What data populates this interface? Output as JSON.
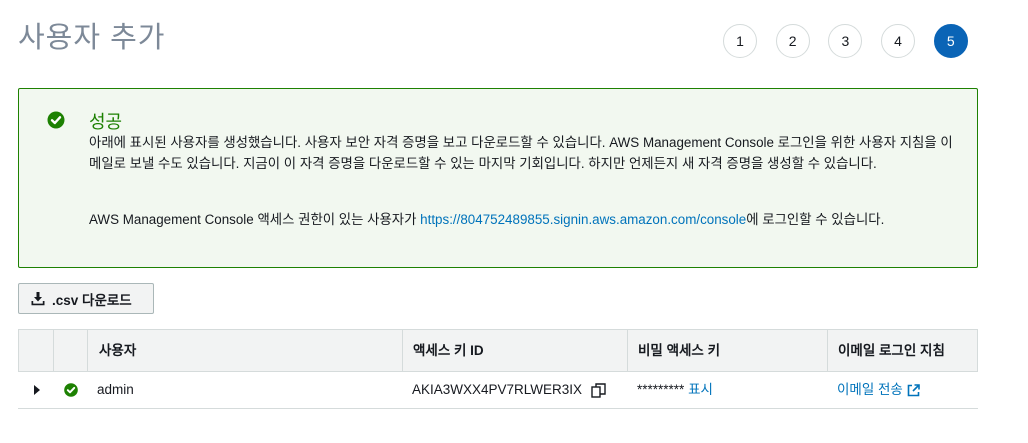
{
  "page": {
    "title": "사용자 추가"
  },
  "steps": [
    {
      "label": "1",
      "active": false
    },
    {
      "label": "2",
      "active": false
    },
    {
      "label": "3",
      "active": false
    },
    {
      "label": "4",
      "active": false
    },
    {
      "label": "5",
      "active": true
    }
  ],
  "alert": {
    "icon": "check-circle-icon",
    "title": "성공",
    "body": "아래에 표시된 사용자를 생성했습니다. 사용자 보안 자격 증명을 보고 다운로드할 수 있습니다. AWS Management Console 로그인을 위한 사용자 지침을 이메일로 보낼 수도 있습니다. 지금이 이 자격 증명을 다운로드할 수 있는 마지막 기회입니다. 하지만 언제든지 새 자격 증명을 생성할 수 있습니다.",
    "console_prefix": "AWS Management Console 액세스 권한이 있는 사용자가 ",
    "console_link": "https://804752489855.signin.aws.amazon.com/console",
    "console_suffix": "에 로그인할 수 있습니다.",
    "color": "#1d8102"
  },
  "toolbar": {
    "download_csv_label": ".csv 다운로드",
    "download_icon": "download-icon"
  },
  "table": {
    "columns": [
      "사용자",
      "액세스 키 ID",
      "비밀 액세스 키",
      "이메일 로그인 지침"
    ],
    "rows": [
      {
        "user": "admin",
        "access_key_id": "AKIA3WXX4PV7RLWER3IX",
        "secret_masked": "*********",
        "secret_show_label": "표시",
        "email_label": "이메일 전송"
      }
    ]
  },
  "colors": {
    "accent": "#0a64b6",
    "link": "#0073bb",
    "success": "#1d8102"
  }
}
